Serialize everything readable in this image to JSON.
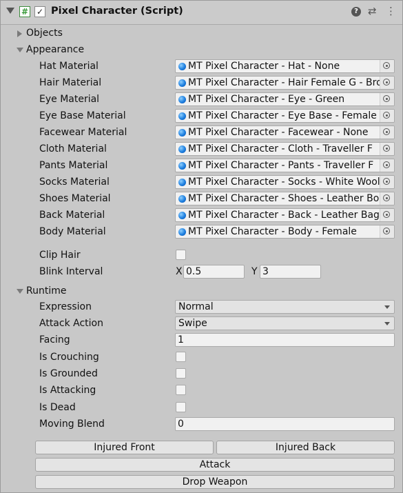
{
  "header": {
    "title": "Pixel Character (Script)",
    "icons": {
      "fold": "chevron-down-icon",
      "script": "csharp-script-icon",
      "enabled": "checkbox-icon",
      "help": "help-icon",
      "presets": "presets-icon",
      "menu": "kebab-menu-icon"
    }
  },
  "objects": {
    "label": "Objects"
  },
  "appearance": {
    "label": "Appearance",
    "materials": [
      {
        "label": "Hat Material",
        "value": "MT Pixel Character - Hat - None"
      },
      {
        "label": "Hair Material",
        "value": "MT Pixel Character - Hair Female G - Bro"
      },
      {
        "label": "Eye Material",
        "value": "MT Pixel Character - Eye - Green"
      },
      {
        "label": "Eye Base Material",
        "value": "MT Pixel Character - Eye Base - Female"
      },
      {
        "label": "Facewear Material",
        "value": "MT Pixel Character - Facewear - None"
      },
      {
        "label": "Cloth Material",
        "value": "MT Pixel Character - Cloth - Traveller F"
      },
      {
        "label": "Pants Material",
        "value": "MT Pixel Character - Pants - Traveller F"
      },
      {
        "label": "Socks Material",
        "value": "MT Pixel Character - Socks - White Wool"
      },
      {
        "label": "Shoes Material",
        "value": "MT Pixel Character - Shoes - Leather Bo"
      },
      {
        "label": "Back Material",
        "value": "MT Pixel Character - Back - Leather Bag"
      },
      {
        "label": "Body Material",
        "value": "MT Pixel Character - Body - Female"
      }
    ],
    "clip_hair": {
      "label": "Clip Hair",
      "checked": false
    },
    "blink_interval": {
      "label": "Blink Interval",
      "x_label": "X",
      "x": "0.5",
      "y_label": "Y",
      "y": "3"
    }
  },
  "runtime": {
    "label": "Runtime",
    "expression": {
      "label": "Expression",
      "value": "Normal"
    },
    "attack_action": {
      "label": "Attack Action",
      "value": "Swipe"
    },
    "facing": {
      "label": "Facing",
      "value": "1"
    },
    "is_crouching": {
      "label": "Is Crouching",
      "checked": false
    },
    "is_grounded": {
      "label": "Is Grounded",
      "checked": false
    },
    "is_attacking": {
      "label": "Is Attacking",
      "checked": false
    },
    "is_dead": {
      "label": "Is Dead",
      "checked": false
    },
    "moving_blend": {
      "label": "Moving Blend",
      "value": "0"
    }
  },
  "buttons": {
    "injured_front": "Injured Front",
    "injured_back": "Injured Back",
    "attack": "Attack",
    "drop_weapon": "Drop Weapon"
  },
  "colors": {
    "panel_bg": "#c8c8c8",
    "field_bg": "#f1f1f1",
    "material_icon": "#1d7fe0",
    "script_icon": "#3a9a3a"
  }
}
